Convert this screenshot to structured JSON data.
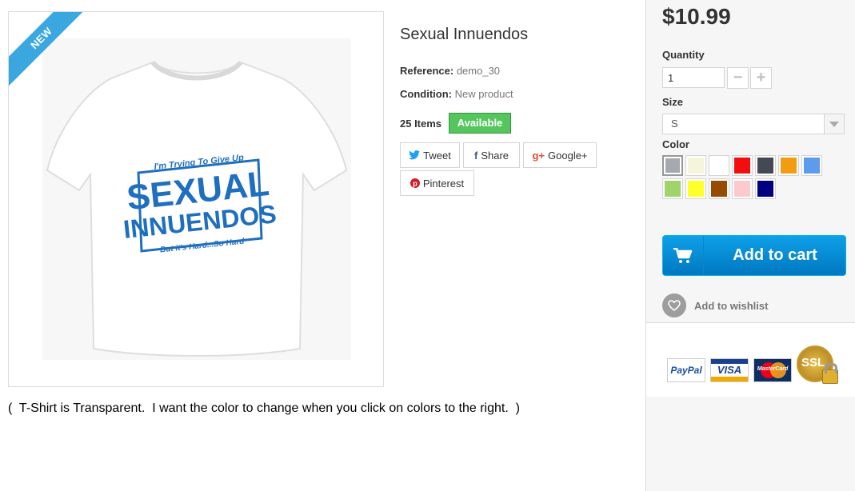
{
  "product": {
    "badge": "NEW",
    "title": "Sexual Innuendos",
    "reference_label": "Reference:",
    "reference_value": "demo_30",
    "condition_label": "Condition:",
    "condition_value": "New product",
    "items": "25 Items",
    "availability": "Available",
    "shirt_print": {
      "top_line": "I'm Trying To Give Up",
      "main_line1": "SEXUAL",
      "main_line2": "INNUENDOS",
      "bottom_line": "But it's Hard...So Hard"
    }
  },
  "share": {
    "tweet": "Tweet",
    "share": "Share",
    "google": "Google+",
    "pinterest": "Pinterest"
  },
  "note": "(  T-Shirt is Transparent.  I want the color to change when you click on colors to the right.  )",
  "panel": {
    "price": "$10.99",
    "quantity_label": "Quantity",
    "quantity_value": "1",
    "minus": "−",
    "plus": "+",
    "size_label": "Size",
    "size_value": "S",
    "color_label": "Color",
    "colors": [
      "#a7a9b0",
      "#f5f5dc",
      "#ffffff",
      "#f30e0e",
      "#434a54",
      "#f39c11",
      "#5d9cec",
      "#a0d468",
      "#ffff29",
      "#964b00",
      "#fccacd",
      "#000080"
    ],
    "selected_color": 0,
    "add_to_cart": "Add to cart",
    "wishlist": "Add to wishlist",
    "payments": [
      "PayPal",
      "VISA",
      "MasterCard",
      "SSL"
    ]
  }
}
